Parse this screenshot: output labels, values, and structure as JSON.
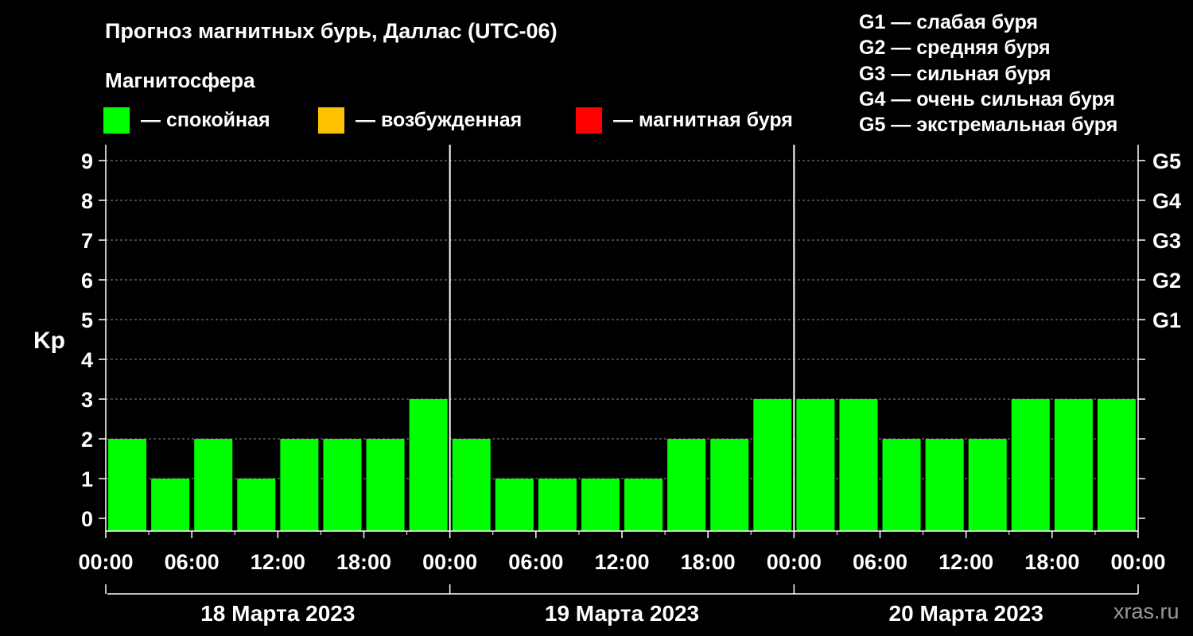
{
  "header": {
    "title": "Прогноз магнитных бурь, Даллас (UTC-06)",
    "subtitle": "Магнитосфера"
  },
  "legend": [
    {
      "label": "— спокойная",
      "color": "#00ff00"
    },
    {
      "label": "— возбужденная",
      "color": "#ffc000"
    },
    {
      "label": "— магнитная буря",
      "color": "#ff0000"
    }
  ],
  "storm_levels": [
    "G1 — слабая буря",
    "G2 — средняя буря",
    "G3 — сильная буря",
    "G4 — очень сильная буря",
    "G5 — экстремальная буря"
  ],
  "watermark": "xras.ru",
  "chart_data": {
    "type": "bar",
    "ylabel": "Kp",
    "ylim": [
      0,
      9
    ],
    "y_ticks": [
      0,
      1,
      2,
      3,
      4,
      5,
      6,
      7,
      8,
      9
    ],
    "right_axis_labels": [
      {
        "kp": 5,
        "label": "G1"
      },
      {
        "kp": 6,
        "label": "G2"
      },
      {
        "kp": 7,
        "label": "G3"
      },
      {
        "kp": 8,
        "label": "G4"
      },
      {
        "kp": 9,
        "label": "G5"
      }
    ],
    "grid": "dashed horizontal",
    "x_tick_labels": [
      "00:00",
      "06:00",
      "12:00",
      "18:00",
      "00:00",
      "06:00",
      "12:00",
      "18:00",
      "00:00",
      "06:00",
      "12:00",
      "18:00",
      "00:00"
    ],
    "days": [
      "18 Марта 2023",
      "19 Марта 2023",
      "20 Марта 2023"
    ],
    "values": [
      2,
      1,
      2,
      1,
      2,
      2,
      2,
      3,
      2,
      1,
      1,
      1,
      1,
      2,
      2,
      3,
      3,
      3,
      2,
      2,
      2,
      3,
      3,
      3
    ],
    "bar_color": "#00ff00"
  }
}
